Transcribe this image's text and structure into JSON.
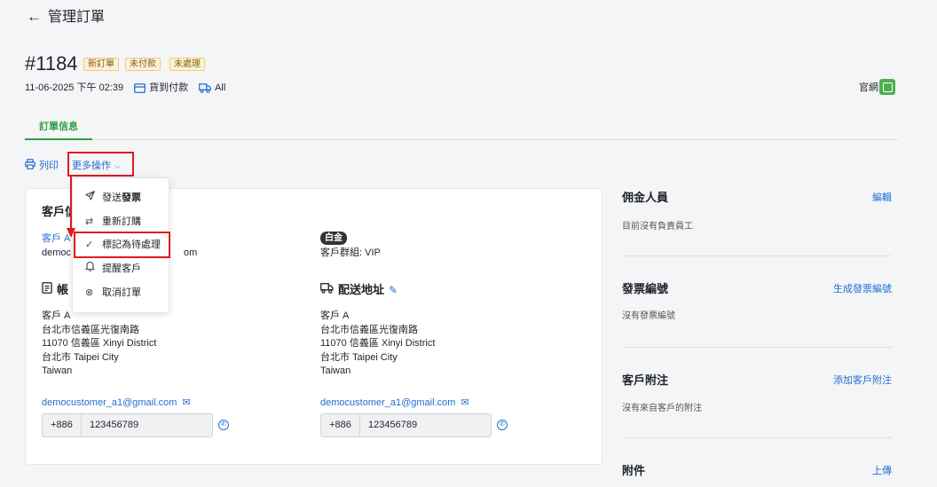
{
  "header": {
    "back_icon": "arrow-left-icon",
    "title": "管理訂單"
  },
  "order": {
    "number": "#1184",
    "badges": [
      "新訂單",
      "未付款",
      "未處理"
    ],
    "datetime": "11-06-2025 下午 02:39",
    "payment_method": "貨到付款",
    "delivery": "All",
    "source_label": "官網"
  },
  "tabs": [
    {
      "label": "訂單信息",
      "active": true
    }
  ],
  "actions": {
    "print_label": "列印",
    "more_label": "更多操作"
  },
  "dropdown": {
    "items": [
      {
        "icon": "send-icon",
        "label_pre": "發送 ",
        "label_bold": "發票"
      },
      {
        "icon": "repeat-icon",
        "label": "重新訂購"
      },
      {
        "icon": "check-icon",
        "label": "標記為待處理"
      },
      {
        "icon": "bell-icon",
        "label": "提醒客戶"
      },
      {
        "icon": "cancel-circle-icon",
        "label": "取消訂單"
      }
    ]
  },
  "customer": {
    "title": "客戶信",
    "name_link": "客戶 A",
    "email_fragment_start": "democ",
    "email_fragment_end": "om",
    "tier_badge": "白金",
    "group_text": "客戶群組: VIP"
  },
  "billing": {
    "title": "帳",
    "address_lines": [
      "客戶 A",
      "台北市信義區光復南路",
      "11070 信義區 Xinyi District",
      "台北市 Taipei City",
      "Taiwan"
    ],
    "email": "democustomer_a1@gmail.com",
    "phone_cc": "+886",
    "phone_number": "123456789"
  },
  "shipping": {
    "title": "配送地址",
    "address_lines": [
      "客戶 A",
      "台北市信義區光復南路",
      "11070 信義區 Xinyi District",
      "台北市 Taipei City",
      "Taiwan"
    ],
    "email": "democustomer_a1@gmail.com",
    "phone_cc": "+886",
    "phone_number": "123456789"
  },
  "sidebar": {
    "commission": {
      "title": "佣金人員",
      "link": "編輯",
      "text": "目前沒有負責員工"
    },
    "invoice": {
      "title": "發票編號",
      "link": "生成發票編號",
      "text": "沒有發票編號"
    },
    "customer_note": {
      "title": "客戶附注",
      "link": "添加客戶附注",
      "text": "沒有來自客戶的附注"
    },
    "attachments": {
      "title": "附件",
      "link": "上傳"
    }
  },
  "colors": {
    "accent_blue": "#1f6fd1",
    "tab_green": "#2f9e44",
    "highlight_red": "#e01b1b"
  }
}
